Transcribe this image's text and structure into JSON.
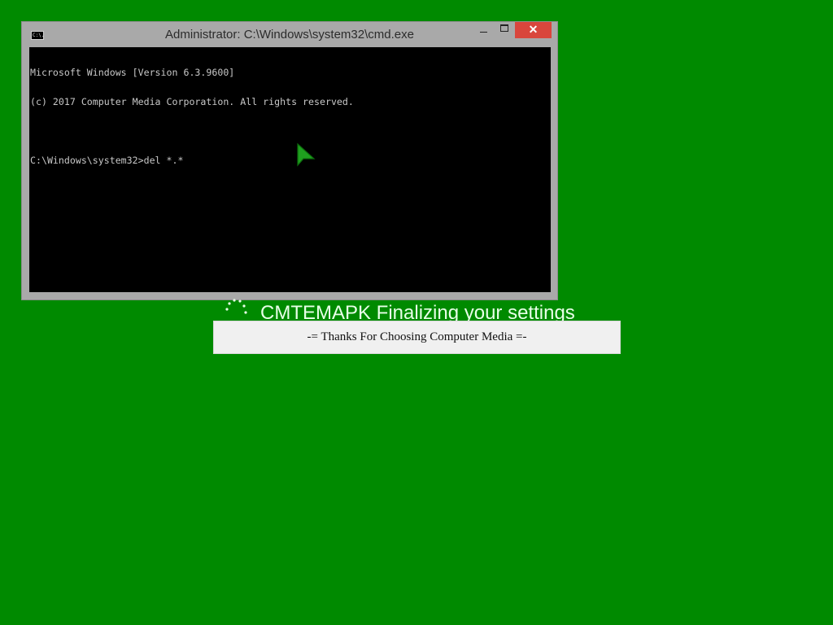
{
  "desktop": {
    "background_color": "#008a00"
  },
  "cmd_window": {
    "icon_label": "C:\\.",
    "title": "Administrator: C:\\Windows\\system32\\cmd.exe",
    "buttons": {
      "minimize_icon": "minimize-icon",
      "maximize_icon": "maximize-icon",
      "close_icon": "close-icon",
      "close_glyph": "✕"
    },
    "console_lines": [
      "Microsoft Windows [Version 6.3.9600]",
      "(c) 2017 Computer Media Corporation. All rights reserved.",
      "",
      "C:\\Windows\\system32>del *.*"
    ],
    "close_color": "#d9463c"
  },
  "cursor": {
    "icon": "arrow-cursor-icon",
    "color": "#1fa01f"
  },
  "status": {
    "spinner_icon": "loading-spinner-icon",
    "text": "CMTEMAPK Finalizing your settings"
  },
  "message_box": {
    "text": "-= Thanks For Choosing Computer Media =-"
  }
}
